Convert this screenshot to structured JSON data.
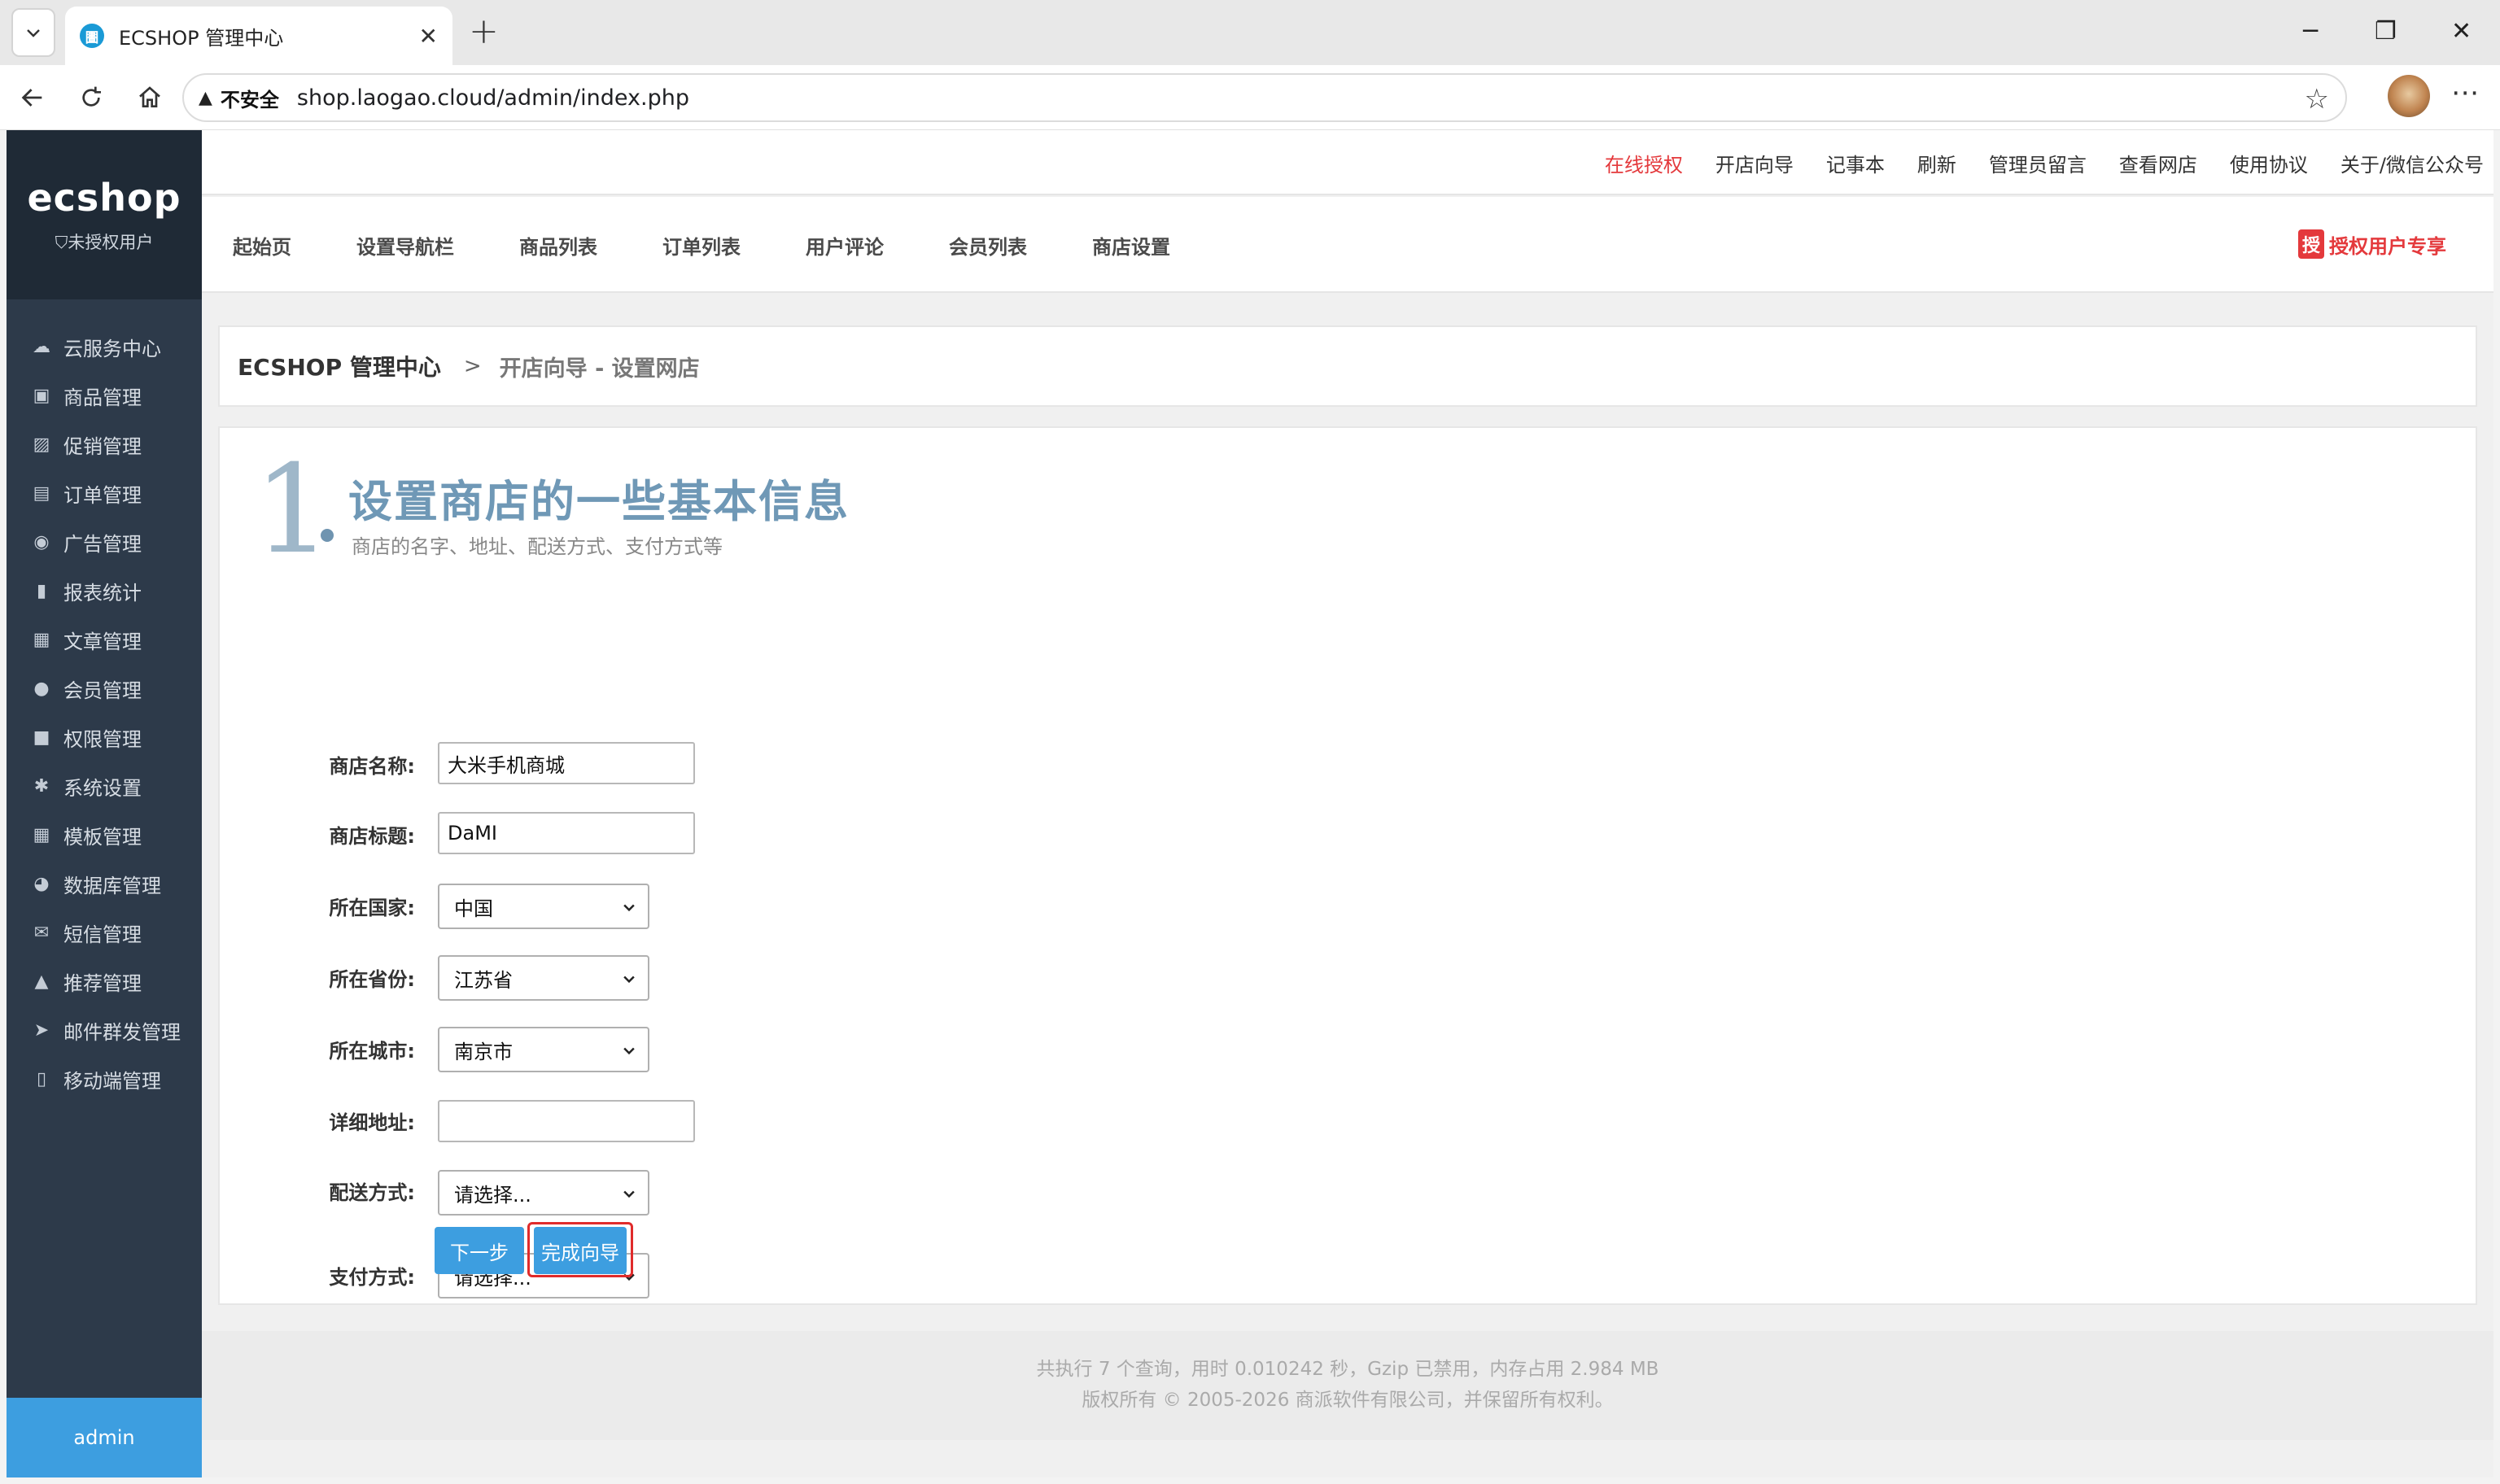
{
  "browser": {
    "tab_title": "ECSHOP 管理中心",
    "tab_favicon": "圕",
    "insecure_label": "不安全",
    "url": "shop.laogao.cloud/admin/index.php",
    "window_controls": [
      "─",
      "❐",
      "✕"
    ]
  },
  "sidebar": {
    "logo": "ecshop",
    "unauthorized": "未授权用户",
    "user": "admin",
    "items": [
      {
        "label": "云服务中心",
        "icon": "cloud-icon",
        "glyph": "☁"
      },
      {
        "label": "商品管理",
        "icon": "goods-icon",
        "glyph": "▣"
      },
      {
        "label": "促销管理",
        "icon": "promotion-icon",
        "glyph": "▨"
      },
      {
        "label": "订单管理",
        "icon": "order-icon",
        "glyph": "▤"
      },
      {
        "label": "广告管理",
        "icon": "ad-icon",
        "glyph": "◉"
      },
      {
        "label": "报表统计",
        "icon": "chart-icon",
        "glyph": "▮"
      },
      {
        "label": "文章管理",
        "icon": "article-icon",
        "glyph": "▦"
      },
      {
        "label": "会员管理",
        "icon": "user-icon",
        "glyph": "●"
      },
      {
        "label": "权限管理",
        "icon": "lock-icon",
        "glyph": "■"
      },
      {
        "label": "系统设置",
        "icon": "gear-icon",
        "glyph": "✱"
      },
      {
        "label": "模板管理",
        "icon": "template-icon",
        "glyph": "▦"
      },
      {
        "label": "数据库管理",
        "icon": "database-icon",
        "glyph": "◕"
      },
      {
        "label": "短信管理",
        "icon": "mail-icon",
        "glyph": "✉"
      },
      {
        "label": "推荐管理",
        "icon": "thumbs-up-icon",
        "glyph": "▲"
      },
      {
        "label": "邮件群发管理",
        "icon": "send-icon",
        "glyph": "➤"
      },
      {
        "label": "移动端管理",
        "icon": "mobile-icon",
        "glyph": "▯"
      }
    ]
  },
  "topbar": {
    "links": [
      "在线授权",
      "开店向导",
      "记事本",
      "刷新",
      "管理员留言",
      "查看网店",
      "使用协议",
      "关于/微信公众号"
    ],
    "highlight_color": "#e4393c"
  },
  "navbar": {
    "items": [
      "起始页",
      "设置导航栏",
      "商品列表",
      "订单列表",
      "用户评论",
      "会员列表",
      "商店设置"
    ],
    "promo_badge": "授",
    "promo_label": "授权用户专享"
  },
  "breadcrumb": {
    "home": "ECSHOP 管理中心",
    "separator": ">",
    "current": "开店向导 - 设置网店"
  },
  "step": {
    "number": "1",
    "title": "设置商店的一些基本信息",
    "subtitle": "商店的名字、地址、配送方式、支付方式等"
  },
  "form": {
    "shop_name": {
      "label": "商店名称:",
      "value": "大米手机商城"
    },
    "shop_title": {
      "label": "商店标题:",
      "value": "DaMI"
    },
    "country": {
      "label": "所在国家:",
      "value": "中国"
    },
    "province": {
      "label": "所在省份:",
      "value": "江苏省"
    },
    "city": {
      "label": "所在城市:",
      "value": "南京市"
    },
    "address": {
      "label": "详细地址:",
      "value": ""
    },
    "shipping": {
      "label": "配送方式:",
      "value": "请选择..."
    },
    "payment": {
      "label": "支付方式:",
      "value": "请选择..."
    },
    "next_button": "下一步",
    "finish_button": "完成向导"
  },
  "footer": {
    "stats": "共执行 7 个查询，用时 0.010242 秒，Gzip 已禁用，内存占用 2.984 MB",
    "copyright": "版权所有 © 2005-2026 商派软件有限公司，并保留所有权利。"
  },
  "colors": {
    "accent": "#3d9ee0",
    "sidebar_bg": "#2d3a4a",
    "step_title": "#6f98b6",
    "highlight_border": "#e02b2b"
  }
}
